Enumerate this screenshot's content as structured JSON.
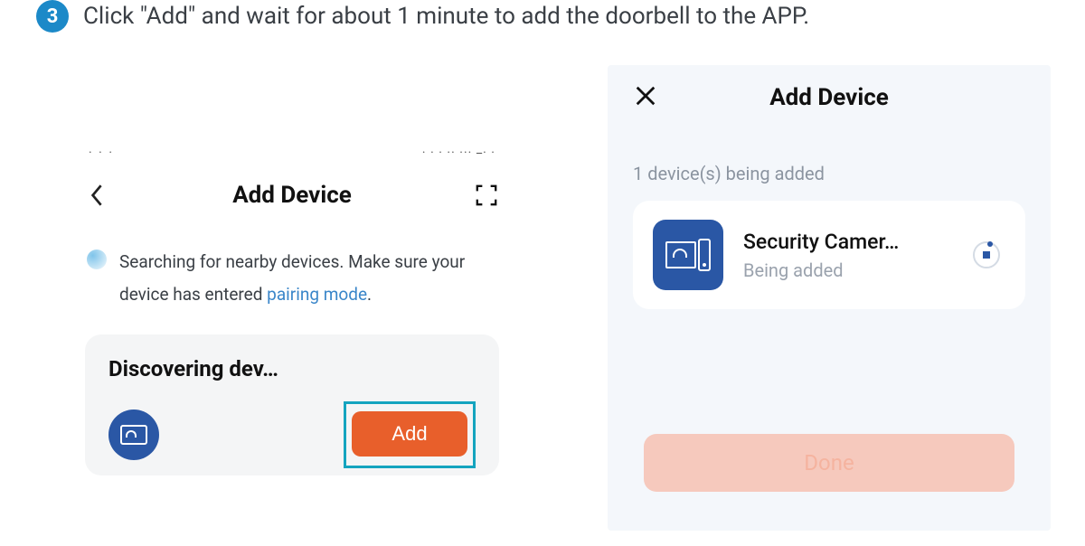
{
  "step": {
    "number": "3",
    "text": "Click \"Add\" and wait for about 1 minute to add the doorbell to the APP."
  },
  "left": {
    "title": "Add Device",
    "search_prefix": "Searching for nearby devices. Make sure your device has entered ",
    "pairing_link": "pairing mode",
    "search_suffix": ".",
    "discover_title": "Discovering dev…",
    "add_label": "Add"
  },
  "right": {
    "title": "Add Device",
    "status": "1 device(s) being added",
    "device_name": "Security Camer…",
    "device_status": "Being added",
    "done_label": "Done"
  }
}
